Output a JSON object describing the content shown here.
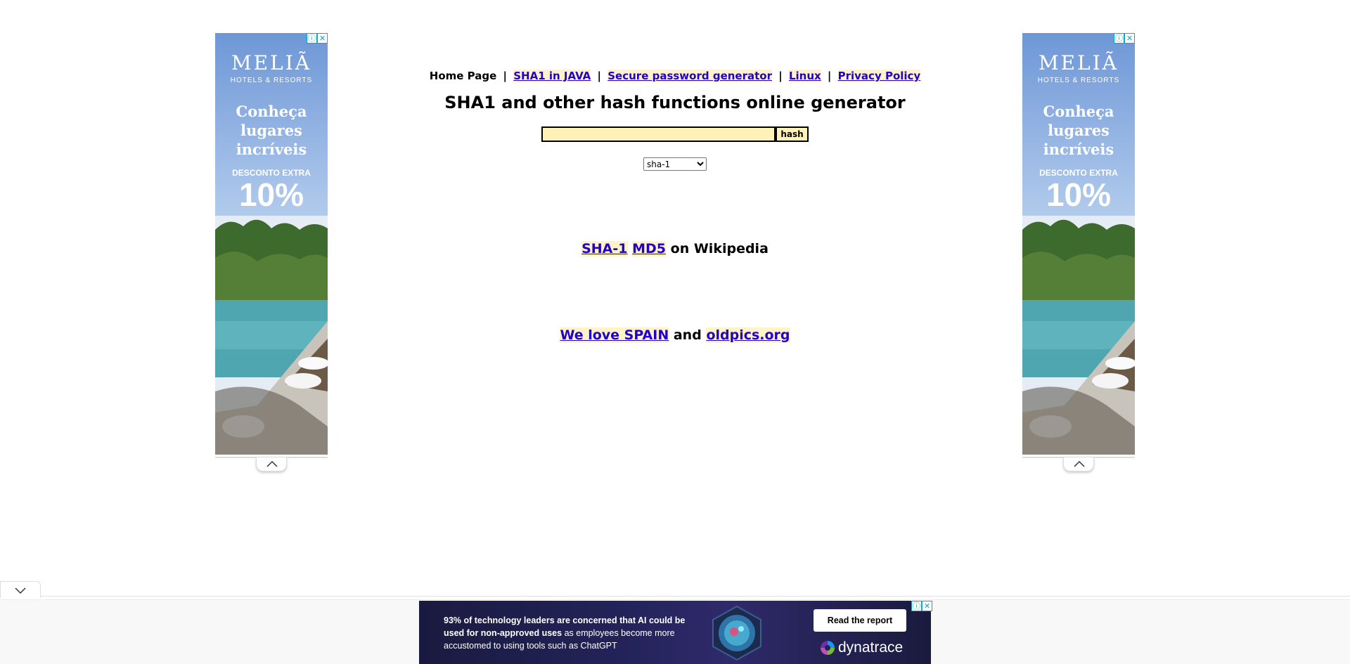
{
  "nav": {
    "home": "Home Page",
    "separator": "|",
    "links": [
      "SHA1 in JAVA",
      "Secure password generator",
      "Linux",
      "Privacy Policy"
    ]
  },
  "title": "SHA1 and other hash functions online generator",
  "form": {
    "input_value": "",
    "button_label": "hash",
    "algorithm_selected": "sha-1"
  },
  "wiki": {
    "link1": "SHA-1",
    "link2": "MD5",
    "suffix": "on Wikipedia"
  },
  "promo": {
    "link1": "We love SPAIN",
    "middle": "and",
    "link2": "oldpics.org"
  },
  "side_ad": {
    "brand": "MELIÃ",
    "sub": "HOTELS & RESORTS",
    "headline_lines": [
      "Conheça",
      "lugares",
      "incríveis"
    ],
    "discount": "DESCONTO EXTRA",
    "percent": "10%",
    "info_glyph": "ⓘ",
    "close_glyph": "✕"
  },
  "bottom_ad": {
    "text_bold": "93% of technology leaders are concerned that AI could be used for non-approved uses",
    "text_rest": " as employees become more accustomed to using tools such as ChatGPT",
    "cta": "Read the report",
    "logo": "dynatrace"
  },
  "colors": {
    "link": "#2200cc",
    "link_highlight": "#fef2c9",
    "input_bg": "#fff2b8",
    "ad_accent": "#00aecd"
  }
}
